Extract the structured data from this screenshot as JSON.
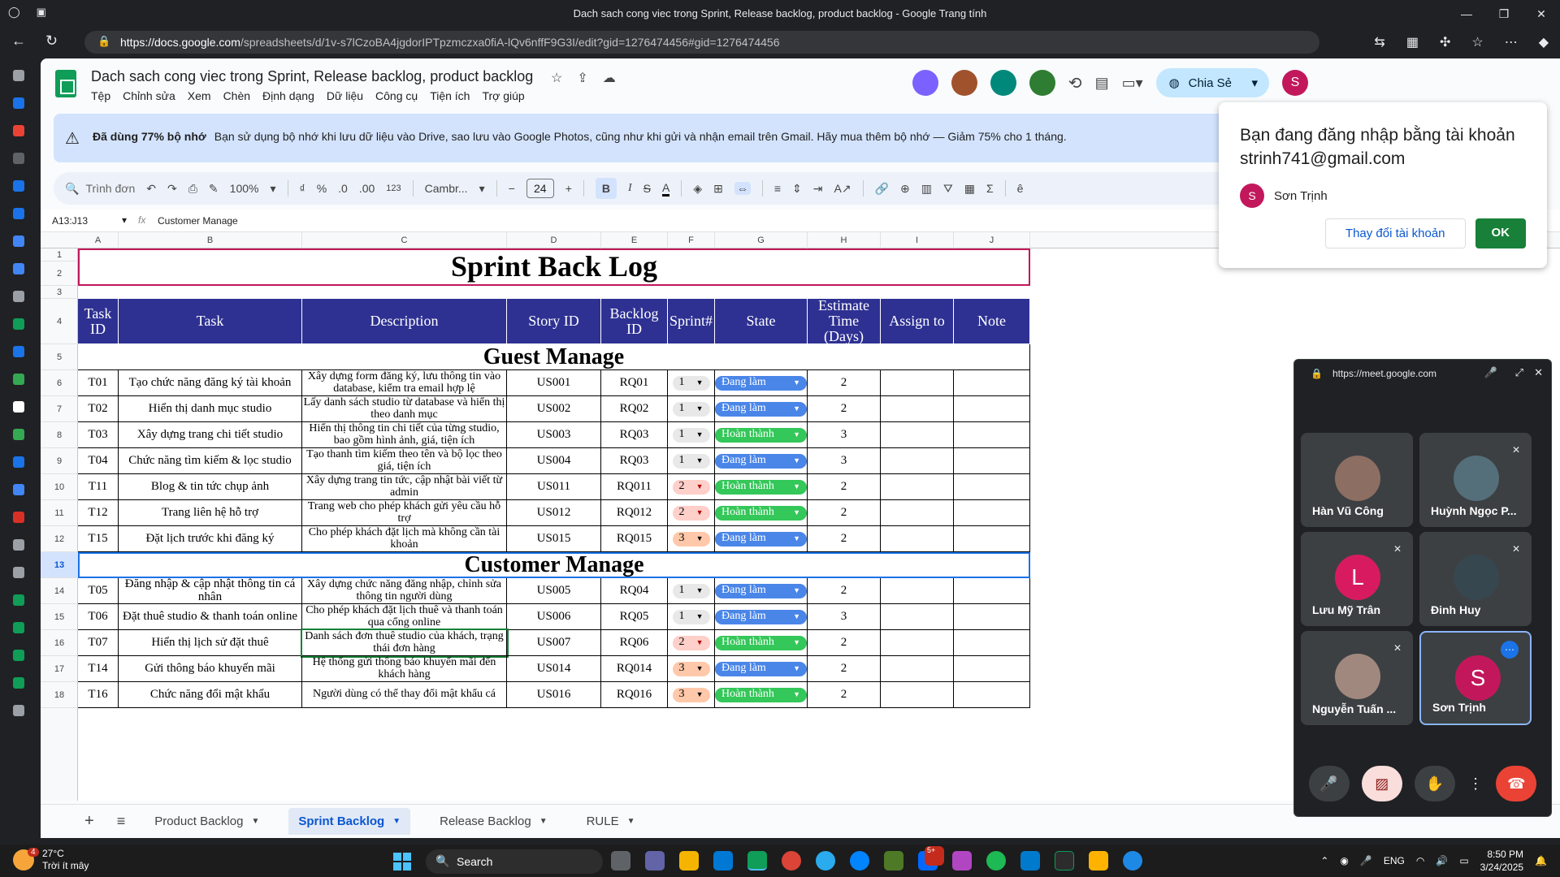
{
  "browser": {
    "window_title": "Dach sach cong viec trong Sprint, Release backlog, product backlog - Google Trang tính",
    "url_host": "https://docs.google.com",
    "url_path": "/spreadsheets/d/1v-s7lCzoBA4jgdorIPTpzmczxa0fiA-lQv6nffF9G3I/edit?gid=1276474456#gid=1276474456"
  },
  "doc": {
    "title": "Dach sach cong viec trong Sprint, Release backlog, product backlog",
    "menu": [
      "Tệp",
      "Chỉnh sửa",
      "Xem",
      "Chèn",
      "Định dạng",
      "Dữ liệu",
      "Công cụ",
      "Tiện ích",
      "Trợ giúp"
    ],
    "share_label": "Chia Sẻ",
    "user_initial": "S"
  },
  "banner": {
    "bold": "Đã dùng 77% bộ nhớ",
    "text": "Bạn sử dụng bộ nhớ khi lưu dữ liệu vào Drive, sao lưu vào Google Photos, cũng như khi gửi và nhận email trên Gmail. Hãy mua thêm bộ nhớ — Giảm 75% cho 1 tháng."
  },
  "toolbar": {
    "search": "Trình đơn",
    "zoom": "100%",
    "percent": "%",
    "dec_minus": ".0",
    "dec_plus": ".00",
    "num_fmt": "123",
    "font": "Cambr...",
    "font_size": "24",
    "bold": "B",
    "italic": "I"
  },
  "formula_bar": {
    "name_box": "A13:J13",
    "value": "Customer Manage"
  },
  "columns": [
    "A",
    "B",
    "C",
    "D",
    "E",
    "F",
    "G",
    "H",
    "I",
    "J"
  ],
  "rows_visible": [
    "1",
    "2",
    "3",
    "4",
    "5",
    "6",
    "7",
    "8",
    "9",
    "10",
    "11",
    "12",
    "13",
    "14",
    "15",
    "16",
    "17",
    "18"
  ],
  "sheet": {
    "title": "Sprint Back Log",
    "headers": [
      "Task ID",
      "Task",
      "Description",
      "Story ID",
      "Backlog ID",
      "Sprint#",
      "State",
      "Estimate Time (Days)",
      "Assign to",
      "Note"
    ],
    "section1": "Guest Manage",
    "section2": "Customer Manage",
    "guest_rows": [
      {
        "id": "T01",
        "task": "Tạo chức năng đăng ký tài khoản",
        "desc": "Xây dựng form đăng ký, lưu thông tin vào database, kiểm tra email hợp lệ",
        "story": "US001",
        "backlog": "RQ01",
        "sprint": "1",
        "state": "Đang làm",
        "est": "2"
      },
      {
        "id": "T02",
        "task": "Hiển thị danh mục studio",
        "desc": "Lấy danh sách studio từ database và hiển thị theo danh mục",
        "story": "US002",
        "backlog": "RQ02",
        "sprint": "1",
        "state": "Đang làm",
        "est": "2"
      },
      {
        "id": "T03",
        "task": "Xây dựng trang chi tiết studio",
        "desc": "Hiển thị thông tin chi tiết của từng studio, bao gồm hình ảnh, giá, tiện ích",
        "story": "US003",
        "backlog": "RQ03",
        "sprint": "1",
        "state": "Hoàn thành",
        "est": "3"
      },
      {
        "id": "T04",
        "task": "Chức năng tìm kiếm & lọc studio",
        "desc": "Tạo thanh tìm kiếm theo tên và bộ lọc theo giá, tiện ích",
        "story": "US004",
        "backlog": "RQ03",
        "sprint": "1",
        "state": "Đang làm",
        "est": "3"
      },
      {
        "id": "T11",
        "task": "Blog & tin tức chụp ảnh",
        "desc": "Xây dựng trang tin tức, cập nhật bài viết từ admin",
        "story": "US011",
        "backlog": "RQ011",
        "sprint": "2",
        "state": "Hoàn thành",
        "est": "2"
      },
      {
        "id": "T12",
        "task": "Trang liên hệ hỗ trợ",
        "desc": "Trang web cho phép khách gửi yêu cầu hỗ trợ",
        "story": "US012",
        "backlog": "RQ012",
        "sprint": "2",
        "state": "Hoàn thành",
        "est": "2"
      },
      {
        "id": "T15",
        "task": "Đặt lịch trước khi đăng ký",
        "desc": "Cho phép khách đặt lịch mà không cần tài khoản",
        "story": "US015",
        "backlog": "RQ015",
        "sprint": "3",
        "state": "Đang làm",
        "est": "2"
      }
    ],
    "customer_rows": [
      {
        "id": "T05",
        "task": "Đăng nhập & cập nhật thông tin cá nhân",
        "desc": "Xây dựng chức năng đăng nhập, chỉnh sửa thông tin người dùng",
        "story": "US005",
        "backlog": "RQ04",
        "sprint": "1",
        "state": "Đang làm",
        "est": "2"
      },
      {
        "id": "T06",
        "task": "Đặt thuê studio & thanh toán online",
        "desc": "Cho phép khách đặt lịch thuê và thanh toán qua cổng online",
        "story": "US006",
        "backlog": "RQ05",
        "sprint": "1",
        "state": "Đang làm",
        "est": "3"
      },
      {
        "id": "T07",
        "task": "Hiển thị lịch sử đặt thuê",
        "desc": "Danh sách đơn thuê studio của khách, trạng thái đơn hàng",
        "story": "US007",
        "backlog": "RQ06",
        "sprint": "2",
        "state": "Hoàn thành",
        "est": "2"
      },
      {
        "id": "T14",
        "task": "Gửi thông báo khuyến mãi",
        "desc": "Hệ thống gửi thông báo khuyến mãi đến khách hàng",
        "story": "US014",
        "backlog": "RQ014",
        "sprint": "3",
        "state": "Đang làm",
        "est": "2"
      },
      {
        "id": "T16",
        "task": "Chức năng đổi mật khẩu",
        "desc": "Người dùng có thể thay đổi mật khẩu cá",
        "story": "US016",
        "backlog": "RQ016",
        "sprint": "3",
        "state": "Hoàn thành",
        "est": "2"
      }
    ]
  },
  "tabs": [
    "Product Backlog",
    "Sprint Backlog",
    "Release Backlog",
    "RULE"
  ],
  "active_tab": "Sprint Backlog",
  "account_popup": {
    "message": "Bạn đang đăng nhập bằng tài khoản strinh741@gmail.com",
    "user": "Sơn Trịnh",
    "initial": "S",
    "change_btn": "Thay đổi tài khoản",
    "ok_btn": "OK"
  },
  "meet": {
    "url": "https://meet.google.com",
    "participants": [
      {
        "name": "Hàn Vũ Công"
      },
      {
        "name": "Huỳnh Ngọc P..."
      },
      {
        "name": "Lưu Mỹ Trân",
        "initial": "L"
      },
      {
        "name": "Đinh Huy"
      },
      {
        "name": "Nguyễn Tuấn ..."
      },
      {
        "name": "Sơn Trịnh",
        "initial": "S"
      }
    ]
  },
  "taskbar": {
    "temp": "27°C",
    "weather": "Trời ít mây",
    "search": "Search",
    "lang": "ENG",
    "time": "8:50 PM",
    "date": "3/24/2025",
    "weather_badge": "4",
    "zalo_badge": "5+"
  },
  "colors": {
    "header_bg": "#2e3192",
    "state_in_progress": "#4a86e8",
    "state_done": "#34c759",
    "accent": "#0b57d0"
  }
}
